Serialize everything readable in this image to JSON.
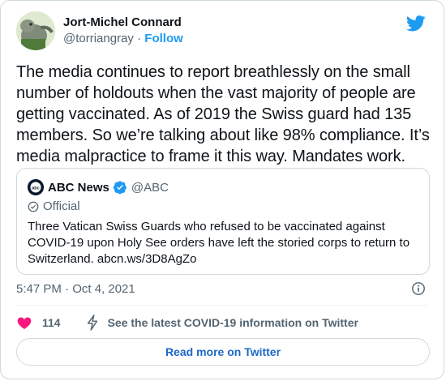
{
  "author": {
    "display_name": "Jort-Michel Connard",
    "handle": "@torriangray",
    "separator": "·",
    "follow_label": "Follow"
  },
  "tweet": {
    "text": "The media continues to report breathlessly on the small number of holdouts when the vast majority of people are getting vaccinated. As of 2019 the Swiss guard had 135 members. So we’re talking about like 98% compliance. It’s media malpractice to frame it this way. Mandates work.",
    "timestamp": "5:47 PM · Oct 4, 2021",
    "likes": "114"
  },
  "quote": {
    "name": "ABC News",
    "handle": "@ABC",
    "badge_label": "Official",
    "text": "Three Vatican Swiss Guards who refused to be vaccinated against COVID-19 upon Holy See orders have left the storied corps to return to Switzerland. abcn.ws/3D8AgZo"
  },
  "footer": {
    "covid_info": "See the latest COVID-19 information on Twitter",
    "read_more": "Read more on Twitter"
  },
  "colors": {
    "twitter_blue": "#1d9bf0",
    "like_red": "#f91880",
    "text_secondary": "#536471",
    "border": "#cfd9de"
  },
  "icons": [
    "twitter-bird-icon",
    "verified-badge-icon",
    "official-badge-icon",
    "info-icon",
    "heart-icon",
    "lightning-bolt-icon"
  ]
}
